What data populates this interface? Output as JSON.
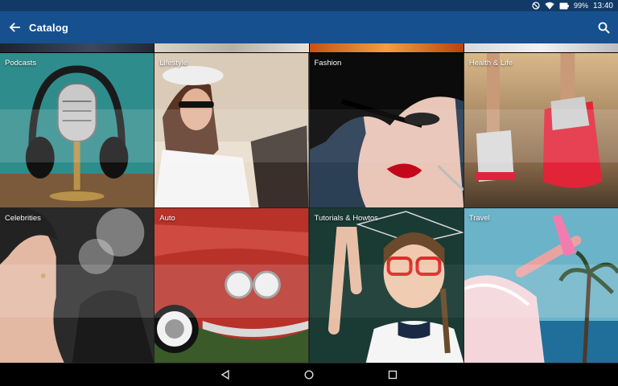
{
  "status_bar": {
    "battery": "99%",
    "time": "13:40",
    "icons": [
      "do-not-disturb-icon",
      "wifi-icon",
      "battery-icon"
    ]
  },
  "app_bar": {
    "title": "Catalog",
    "back_icon": "arrow-left-icon",
    "search_icon": "search-icon"
  },
  "categories": [
    {
      "label": "Podcasts"
    },
    {
      "label": "Lifestyle"
    },
    {
      "label": "Fashion"
    },
    {
      "label": "Health & Life"
    },
    {
      "label": "Celebrities"
    },
    {
      "label": "Auto"
    },
    {
      "label": "Tutorials & Howtos"
    },
    {
      "label": "Travel"
    }
  ],
  "colors": {
    "status_bar": "#113a66",
    "app_bar": "#17508f",
    "nav_bar": "#000000"
  },
  "nav_bar": {
    "icons": [
      "back-triangle-icon",
      "home-circle-icon",
      "recents-square-icon"
    ]
  }
}
